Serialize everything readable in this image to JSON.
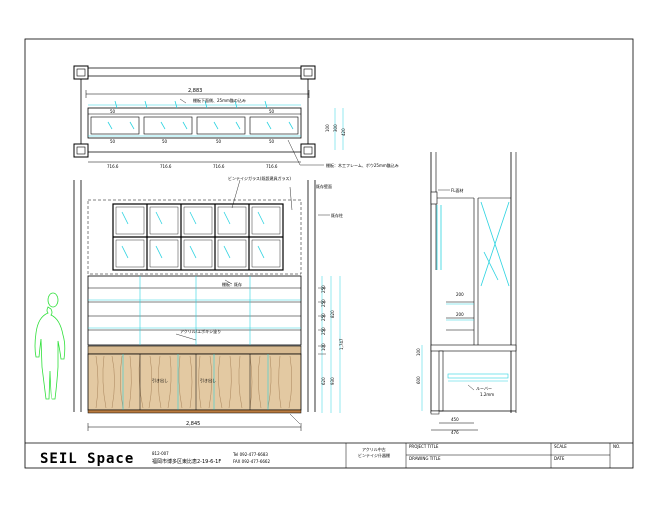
{
  "overall_width_top": "2,883",
  "overall_width_bottom": "2,845",
  "top_segments": [
    "716.6",
    "716.6",
    "716.6",
    "716.6"
  ],
  "top_note_upper": "棚板下面側、25mm鏃の込み",
  "top_note_lower": "棚板：木工フレーム、ボウ25mm鏃込み",
  "top_drawer_label": "50",
  "top_heights": [
    "100",
    "300",
    "420"
  ],
  "front_note_glass": "ビンテイジガラス(既設建具ガラス)",
  "front_note_right1": "既存壁面",
  "front_note_right2": "既存柱",
  "front_note_mid": "棚板：既存",
  "front_note_acrylic": "アクリル/エポキシ塗り",
  "front_note_drawer": "引き出し",
  "front_right_dims": [
    "250",
    "250",
    "250",
    "820",
    "1,747",
    "250",
    "100",
    "620",
    "930"
  ],
  "side_labels": [
    "FL面材",
    "200",
    "200",
    "ルーバー"
  ],
  "side_note": "1.2mm",
  "side_dims_bottom": [
    "450",
    "476"
  ],
  "side_dims_left": [
    "100",
    "600"
  ],
  "title_block": {
    "logo": "SEIL Space",
    "postal": "812-007",
    "address": "福岡市博多区東比恵2-19-6-1F",
    "tel": "Tel 092-477-6683",
    "fax": "FAX 092-477-6662",
    "drawing_desc_1": "アクリル中古",
    "drawing_desc_2": "ビンテイジ什器棚",
    "project_label": "PROJECT TITLE",
    "drawing_label": "DRAWING TITLE",
    "scale_label": "SCALE",
    "date_label": "DATE",
    "no_label": "NO."
  }
}
